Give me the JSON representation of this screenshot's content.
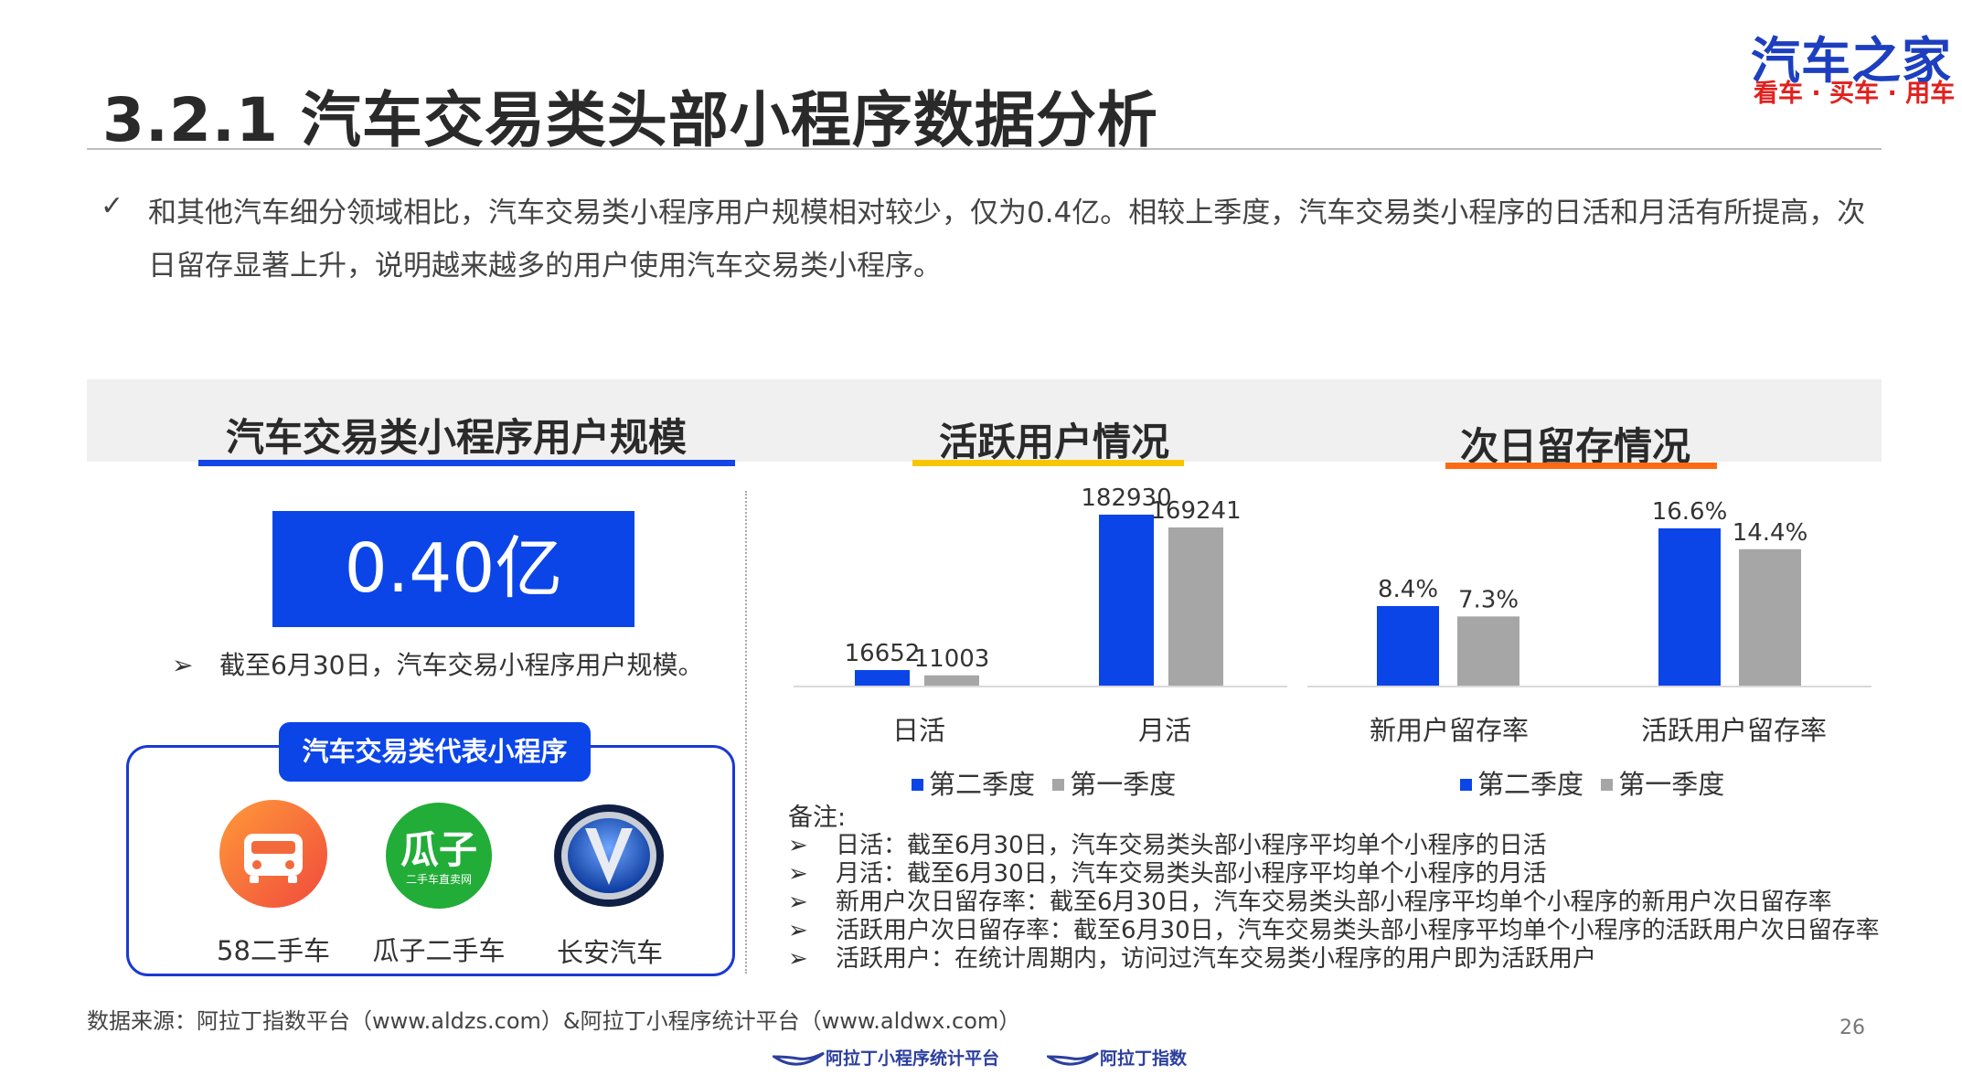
{
  "header": {
    "title": "3.2.1 汽车交易类头部小程序数据分析",
    "logo_main": "汽车之家",
    "logo_sub": "看车 · 买车 · 用车"
  },
  "intro": {
    "check": "✓",
    "text": "和其他汽车细分领域相比，汽车交易类小程序用户规模相对较少，仅为0.4亿。相较上季度，汽车交易类小程序的日活和月活有所提高，次日留存显著上升，说明越来越多的用户使用汽车交易类小程序。"
  },
  "sections": {
    "scale": "汽车交易类小程序用户规模",
    "active": "活跃用户情况",
    "retention": "次日留存情况"
  },
  "colors": {
    "blue": "#0b45e8",
    "gray": "#a6a6a6",
    "yellow": "#f7c600",
    "orange": "#ff6a13",
    "blue_underline": "#1346e6"
  },
  "scale": {
    "value": "0.40亿",
    "note_arrow": "➢",
    "note": "截至6月30日，汽车交易小程序用户规模。"
  },
  "representatives": {
    "label": "汽车交易类代表小程序",
    "apps": [
      {
        "name": "58二手车",
        "icon": "car-icon"
      },
      {
        "name": "瓜子二手车",
        "icon": "guazi-logo-icon",
        "logo_text": "瓜子",
        "logo_sub": "二手车直卖网"
      },
      {
        "name": "长安汽车",
        "icon": "changan-logo-icon"
      }
    ]
  },
  "chart_data": [
    {
      "type": "bar",
      "categories": [
        "日活",
        "月活"
      ],
      "series": [
        {
          "name": "第二季度",
          "values": [
            16652,
            182930
          ]
        },
        {
          "name": "第一季度",
          "values": [
            11003,
            169241
          ]
        }
      ],
      "ylim": [
        0,
        182930
      ],
      "legend": "bottom",
      "grid": false
    },
    {
      "type": "bar",
      "categories": [
        "新用户留存率",
        "活跃用户留存率"
      ],
      "series": [
        {
          "name": "第二季度",
          "values": [
            8.4,
            16.6
          ]
        },
        {
          "name": "第一季度",
          "values": [
            7.3,
            14.4
          ]
        }
      ],
      "value_labels": [
        [
          "8.4%",
          "16.6%"
        ],
        [
          "7.3%",
          "14.4%"
        ]
      ],
      "ylim": [
        0,
        16.6
      ],
      "legend": "bottom",
      "grid": false
    }
  ],
  "notes": {
    "title": "备注:",
    "arrow": "➢",
    "items": [
      "日活：截至6月30日，汽车交易类头部小程序平均单个小程序的日活",
      "月活：截至6月30日，汽车交易类头部小程序平均单个小程序的月活",
      "新用户次日留存率：截至6月30日，汽车交易类头部小程序平均单个小程序的新用户次日留存率",
      "活跃用户次日留存率：截至6月30日，汽车交易类头部小程序平均单个小程序的活跃用户次日留存率",
      "活跃用户：在统计周期内，访问过汽车交易类小程序的用户即为活跃用户"
    ]
  },
  "footer": {
    "source": "数据来源：阿拉丁指数平台（www.aldzs.com）&阿拉丁小程序统计平台（www.aldwx.com）",
    "page": "26",
    "logo1": "阿拉丁小程序统计平台",
    "logo2": "阿拉丁指数"
  }
}
